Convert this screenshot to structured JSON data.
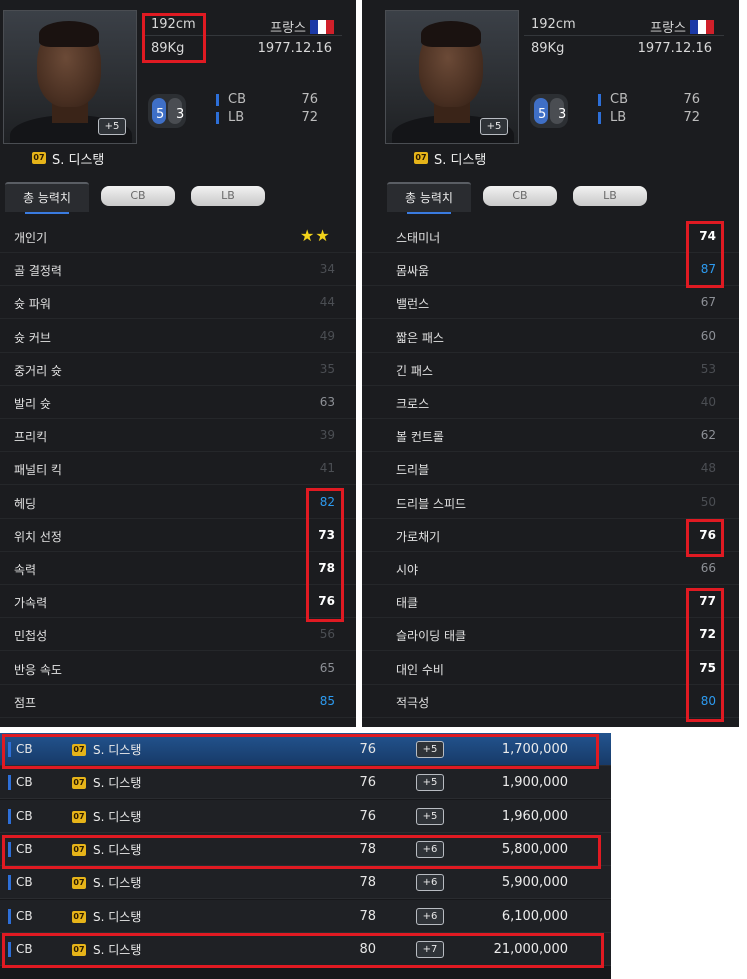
{
  "left_panel": {
    "height": "192cm",
    "weight": "89Kg",
    "nation": "프랑스",
    "birth": "1977.12.16",
    "enhance": "+5",
    "foot_left": "5",
    "foot_right": "3",
    "season": "07",
    "name": "S. 디스탱",
    "positions": [
      {
        "pos": "CB",
        "value": "76"
      },
      {
        "pos": "LB",
        "value": "72"
      }
    ],
    "tabs": [
      "총 능력치",
      "CB",
      "LB"
    ],
    "popularity_label": "개인기",
    "popularity_stars": "★★",
    "stats": [
      {
        "name": "골 결정력",
        "value": "34"
      },
      {
        "name": "슛 파워",
        "value": "44"
      },
      {
        "name": "슛 커브",
        "value": "49"
      },
      {
        "name": "중거리 슛",
        "value": "35"
      },
      {
        "name": "발리 슛",
        "value": "63"
      },
      {
        "name": "프리킥",
        "value": "39"
      },
      {
        "name": "패널티 킥",
        "value": "41"
      },
      {
        "name": "헤딩",
        "value": "82"
      },
      {
        "name": "위치 선정",
        "value": "73"
      },
      {
        "name": "속력",
        "value": "78"
      },
      {
        "name": "가속력",
        "value": "76"
      },
      {
        "name": "민첩성",
        "value": "56"
      },
      {
        "name": "반응 속도",
        "value": "65"
      },
      {
        "name": "점프",
        "value": "85"
      }
    ]
  },
  "right_panel": {
    "height": "192cm",
    "weight": "89Kg",
    "nation": "프랑스",
    "birth": "1977.12.16",
    "enhance": "+5",
    "foot_left": "5",
    "foot_right": "3",
    "season": "07",
    "name": "S. 디스탱",
    "positions": [
      {
        "pos": "CB",
        "value": "76"
      },
      {
        "pos": "LB",
        "value": "72"
      }
    ],
    "tabs": [
      "총 능력치",
      "CB",
      "LB"
    ],
    "stats": [
      {
        "name": "스태미너",
        "value": "74"
      },
      {
        "name": "몸싸움",
        "value": "87"
      },
      {
        "name": "밸런스",
        "value": "67"
      },
      {
        "name": "짧은 패스",
        "value": "60"
      },
      {
        "name": "긴 패스",
        "value": "53"
      },
      {
        "name": "크로스",
        "value": "40"
      },
      {
        "name": "볼 컨트롤",
        "value": "62"
      },
      {
        "name": "드리블",
        "value": "48"
      },
      {
        "name": "드리블 스피드",
        "value": "50"
      },
      {
        "name": "가로채기",
        "value": "76"
      },
      {
        "name": "시야",
        "value": "66"
      },
      {
        "name": "태클",
        "value": "77"
      },
      {
        "name": "슬라이딩 태클",
        "value": "72"
      },
      {
        "name": "대인 수비",
        "value": "75"
      },
      {
        "name": "적극성",
        "value": "80"
      }
    ]
  },
  "listings": [
    {
      "pos": "CB",
      "season": "07",
      "name": "S. 디스탱",
      "ovr": "76",
      "enhance": "+5",
      "price": "1,700,000"
    },
    {
      "pos": "CB",
      "season": "07",
      "name": "S. 디스탱",
      "ovr": "76",
      "enhance": "+5",
      "price": "1,900,000"
    },
    {
      "pos": "CB",
      "season": "07",
      "name": "S. 디스탱",
      "ovr": "76",
      "enhance": "+5",
      "price": "1,960,000"
    },
    {
      "pos": "CB",
      "season": "07",
      "name": "S. 디스탱",
      "ovr": "78",
      "enhance": "+6",
      "price": "5,800,000"
    },
    {
      "pos": "CB",
      "season": "07",
      "name": "S. 디스탱",
      "ovr": "78",
      "enhance": "+6",
      "price": "5,900,000"
    },
    {
      "pos": "CB",
      "season": "07",
      "name": "S. 디스탱",
      "ovr": "78",
      "enhance": "+6",
      "price": "6,100,000"
    },
    {
      "pos": "CB",
      "season": "07",
      "name": "S. 디스탱",
      "ovr": "80",
      "enhance": "+7",
      "price": "21,000,000"
    }
  ],
  "colors": {
    "highlight_box": "#e01a22",
    "stat_high": "#ffffff",
    "stat_blue": "#2d9bf0",
    "stat_dim": "#4b4e53",
    "selected_row": "#23548f"
  }
}
